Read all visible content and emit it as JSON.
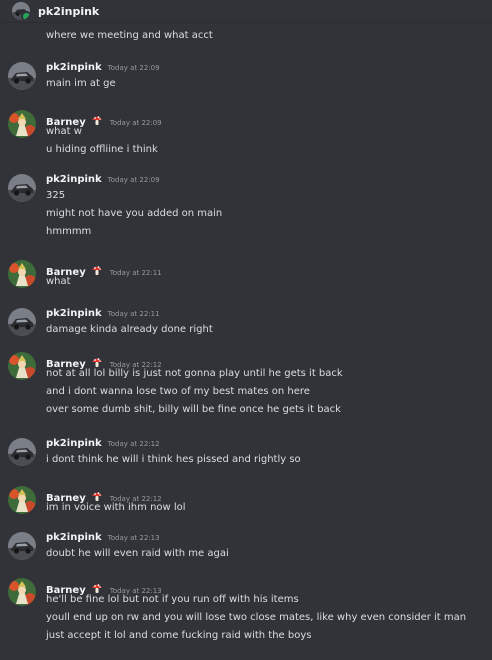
{
  "dm": {
    "recipient": "pk2inpink",
    "status_color": "#23a559"
  },
  "continuation": "where we meeting and what acct",
  "messages": [
    {
      "author": "pk2inpink",
      "avatar": "car-avatar",
      "badge": false,
      "time": "Today at 22:09",
      "lines": [
        "main im at ge"
      ]
    },
    {
      "author": "Barney",
      "avatar": "character-avatar",
      "badge": true,
      "time": "Today at 22:09",
      "lines": [
        "what w",
        "u hiding offliine i think"
      ]
    },
    {
      "author": "pk2inpink",
      "avatar": "car-avatar",
      "badge": false,
      "time": "Today at 22:09",
      "lines": [
        "325",
        "might not have you added on main",
        "hmmmm"
      ]
    },
    {
      "author": "Barney",
      "avatar": "character-avatar",
      "badge": true,
      "time": "Today at 22:11",
      "lines": [
        "what"
      ]
    },
    {
      "author": "pk2inpink",
      "avatar": "car-avatar",
      "badge": false,
      "time": "Today at 22:11",
      "lines": [
        "damage kinda already done right"
      ]
    },
    {
      "author": "Barney",
      "avatar": "character-avatar",
      "badge": true,
      "time": "Today at 22:12",
      "lines": [
        "not at all lol billy is just not gonna play until he gets it back",
        "and i dont wanna lose two of my best mates on here",
        "over some dumb shit, billy will be fine once he gets it back"
      ]
    },
    {
      "author": "pk2inpink",
      "avatar": "car-avatar",
      "badge": false,
      "time": "Today at 22:12",
      "lines": [
        "i dont think he will i think hes pissed and rightly so"
      ]
    },
    {
      "author": "Barney",
      "avatar": "character-avatar",
      "badge": true,
      "time": "Today at 22:12",
      "lines": [
        "im in voice with ihm now lol"
      ]
    },
    {
      "author": "pk2inpink",
      "avatar": "car-avatar",
      "badge": false,
      "time": "Today at 22:13",
      "lines": [
        "doubt he will even raid with me agai"
      ]
    },
    {
      "author": "Barney",
      "avatar": "character-avatar",
      "badge": true,
      "time": "Today at 22:13",
      "lines": [
        "he'll be fine lol but not if you run off with his items",
        "youll end up on rw and you will lose two close mates, like why even consider it man",
        "just accept it lol and come fucking raid with the boys"
      ]
    }
  ]
}
